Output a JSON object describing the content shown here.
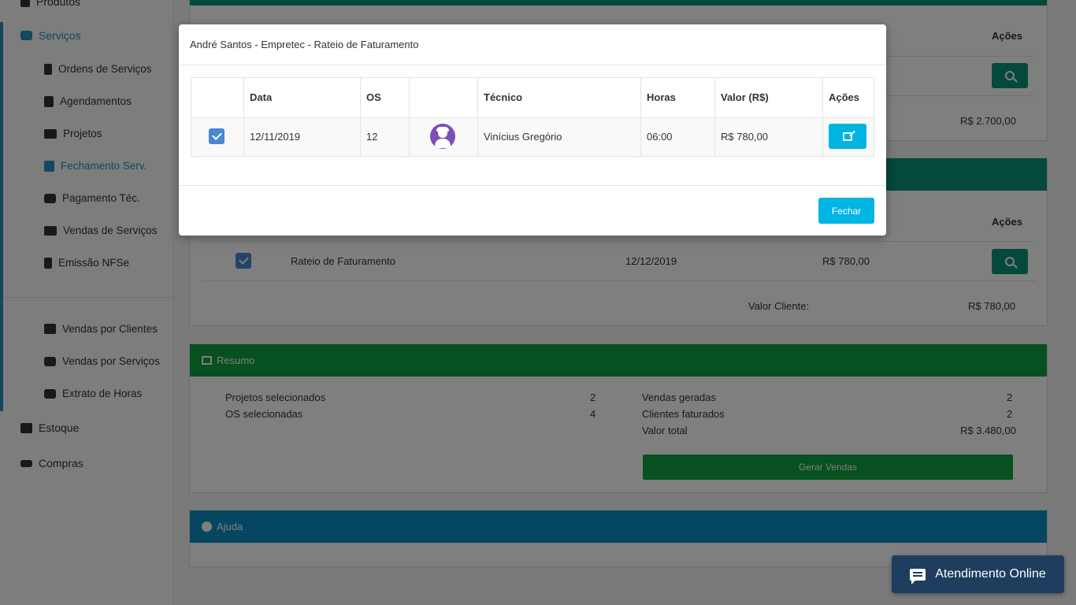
{
  "sidebar": {
    "top_items": [
      {
        "label": "Produtos"
      },
      {
        "label": "Serviços"
      }
    ],
    "sub_items": [
      {
        "label": "Ordens de Serviços"
      },
      {
        "label": "Agendamentos"
      },
      {
        "label": "Projetos"
      },
      {
        "label": "Fechamento Serv."
      },
      {
        "label": "Pagamento Téc."
      },
      {
        "label": "Vendas de Serviços"
      },
      {
        "label": "Emissão NFSe"
      }
    ],
    "report_items": [
      {
        "label": "Vendas por Clientes"
      },
      {
        "label": "Vendas por Serviços"
      },
      {
        "label": "Extrato de Horas"
      }
    ],
    "bottom_items": [
      {
        "label": "Estoque"
      },
      {
        "label": "Compras"
      }
    ],
    "accent_color": "#2a8fbd"
  },
  "background": {
    "card1": {
      "acoes_header": "Ações",
      "total": "R$ 2.700,00"
    },
    "card2": {
      "acoes_header": "Ações",
      "row": {
        "descricao": "Rateio de Faturamento",
        "data": "12/12/2019",
        "valor": "R$ 780,00"
      },
      "valor_cliente_label": "Valor Cliente:",
      "valor_cliente": "R$ 780,00"
    },
    "resumo": {
      "title": "Resumo",
      "projetos_label": "Projetos selecionados",
      "projetos": "2",
      "os_label": "OS selecionadas",
      "os": "4",
      "vendas_label": "Vendas geradas",
      "vendas": "2",
      "clientes_label": "Clientes faturados",
      "clientes": "2",
      "total_label": "Valor total",
      "total": "R$ 3.480,00",
      "button": "Gerar Vendas"
    },
    "ajuda": {
      "title": "Ajuda"
    }
  },
  "modal": {
    "title": "André Santos - Empretec - Rateio de Faturamento",
    "columns": [
      "Data",
      "OS",
      "",
      "Técnico",
      "Horas",
      "Valor (R$)",
      "Ações"
    ],
    "row": {
      "data": "12/11/2019",
      "os": "12",
      "tecnico": "Vinícius Gregório",
      "horas": "06:00",
      "valor": "R$ 780,00"
    },
    "close_button": "Fechar"
  },
  "chat": {
    "label": "Atendimento Online"
  },
  "colors": {
    "teal": "#0a9374",
    "green": "#0fa03f",
    "blue": "#0b8fc1",
    "cyan": "#00b5e2",
    "chat": "#1f3d5e"
  }
}
